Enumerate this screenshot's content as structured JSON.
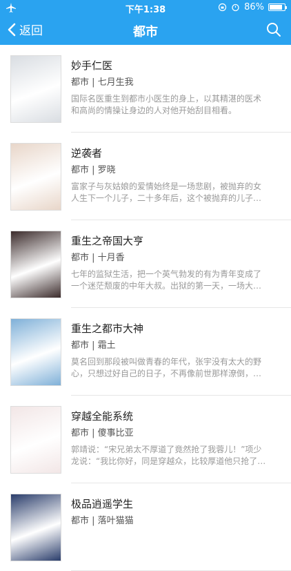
{
  "status": {
    "time": "下午1:38",
    "battery": "86%",
    "battery_level": 0.86
  },
  "nav": {
    "back_label": "返回",
    "title": "都市"
  },
  "books": [
    {
      "title": "妙手仁医",
      "meta": "都市 | 七月生我",
      "desc": "国际名医重生到都市小医生的身上，以其精湛的医术和高尚的情操让身边的人对他开始刮目相看。",
      "cover_color": "#d9dde2"
    },
    {
      "title": "逆袭者",
      "meta": "都市 | 罗晓",
      "desc": "富家子与灰姑娘的爱情始终是一场悲剧，被抛弃的女人生下一个儿子，二十多年后，这个被抛弃的儿子…",
      "cover_color": "#e8d6c9"
    },
    {
      "title": "重生之帝国大亨",
      "meta": "都市 | 十月香",
      "desc": "七年的监狱生活，把一个英气勃发的有为青年变成了一个迷茫颓废的中年大叔。出狱的第一天，一场大…",
      "cover_color": "#3b2b2b"
    },
    {
      "title": "重生之都市大神",
      "meta": "都市 | 霜土",
      "desc": "莫名回到那段被叫做青春的年代，张宇没有太大的野心，只想过好自己的日子，不再像前世那样潦倒，…",
      "cover_color": "#7fb0d8"
    },
    {
      "title": "穿越全能系统",
      "meta": "都市 | 傻事比亚",
      "desc": "郭靖说：“宋兄弟太不厚道了竟然抢了我蓉儿！”项少龙说：“我比你好，同是穿越众，比较厚道他只抢了…",
      "cover_color": "#f2e6e6"
    },
    {
      "title": "极品逍遥学生",
      "meta": "都市 | 落叶猫猫",
      "desc": "",
      "cover_color": "#2a3d6b"
    }
  ]
}
